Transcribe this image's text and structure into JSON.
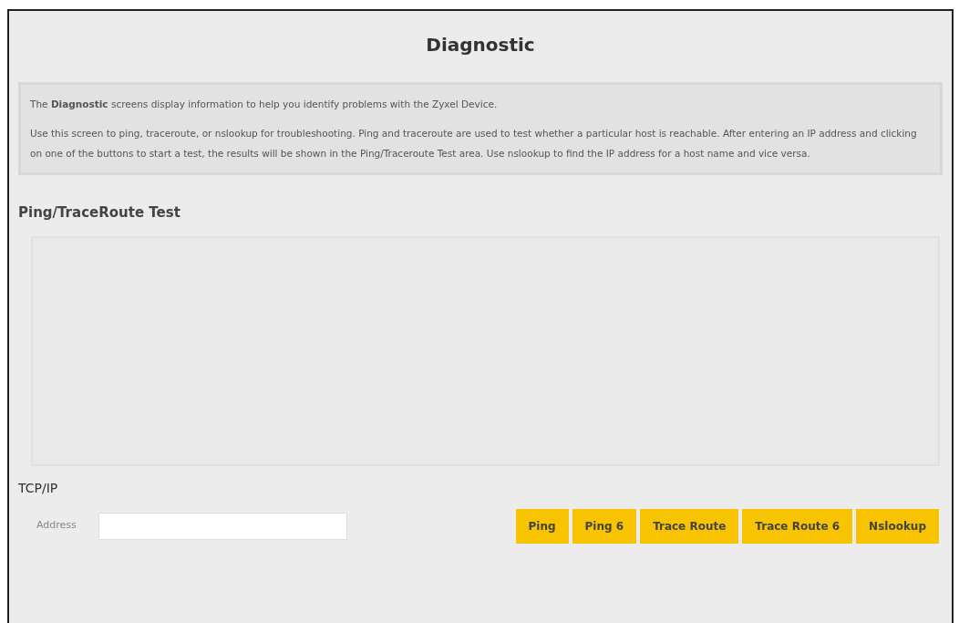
{
  "window": {
    "title": "Diagnostic"
  },
  "description": [
    "The **Diagnostic** screens display information to help you identify problems with the Zyxel Device.",
    "Use this screen to ping, traceroute, or nslookup for troubleshooting. Ping and traceroute are used to test whether a particular host is reachable. After entering an IP address and clicking on one of the buttons to start a test, the results will be shown in the Ping/Traceroute Test area. Use nslookup to find the IP address for a host name and vice versa."
  ],
  "test_section": {
    "heading": "Ping/TraceRoute Test"
  },
  "tcpip": {
    "heading": "TCP/IP",
    "address_label": "Address"
  },
  "buttons": [
    "Ping",
    "Ping 6",
    "Trace Route",
    "Trace Route 6",
    "Nslookup"
  ]
}
